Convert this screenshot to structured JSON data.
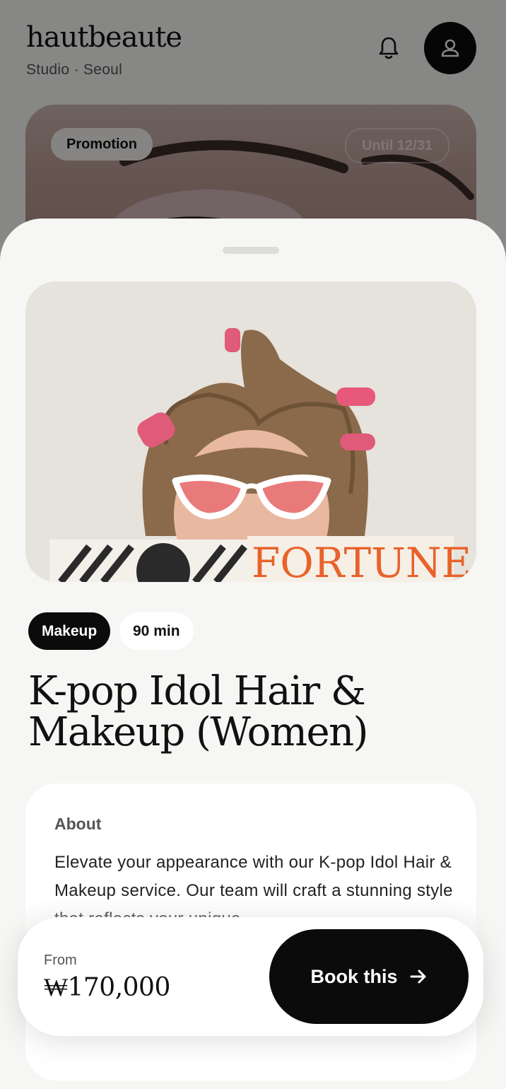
{
  "header": {
    "brand": "hautbeaute",
    "subtitle": "Studio · Seoul"
  },
  "promo": {
    "badge": "Promotion",
    "until": "Until 12/31"
  },
  "service": {
    "category": "Makeup",
    "duration": "90 min",
    "title_line1": "K-pop Idol Hair &",
    "title_line2": "Makeup (Women)",
    "about_label": "About",
    "about_text": "Elevate your appearance with our K-pop Idol Hair & Makeup service. Our team will craft a stunning style that reflects your unique"
  },
  "booking": {
    "from_label": "From",
    "price": "₩170,000",
    "button_label": "Book this"
  },
  "hero_image": {
    "magazine_text": "FORTUNE"
  },
  "icons": {
    "bell": "bell-icon",
    "profile": "user-icon",
    "arrow": "arrow-right-icon"
  },
  "colors": {
    "primary": "#0b0b0b",
    "background": "#f6f6f4",
    "surface": "#ffffff"
  }
}
